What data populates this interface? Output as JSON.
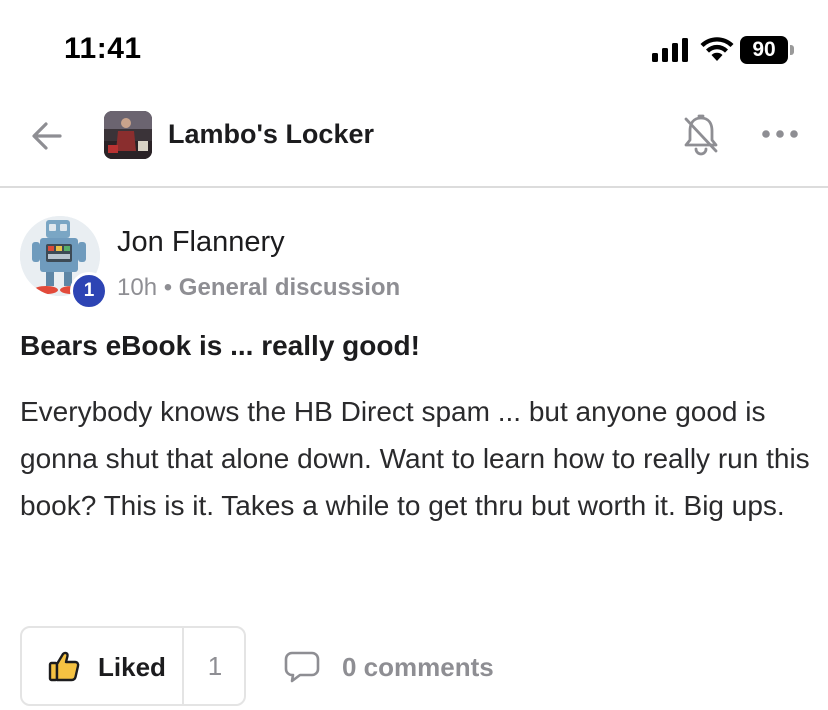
{
  "status_bar": {
    "time": "11:41",
    "battery_level": "90",
    "icons": [
      "signal-icon",
      "wifi-icon",
      "battery-icon"
    ]
  },
  "header": {
    "back_icon": "arrow-left-icon",
    "group_name": "Lambo's Locker",
    "bell_icon": "bell-muted-icon",
    "more_icon": "ellipsis-icon"
  },
  "post": {
    "author": "Jon Flannery",
    "level": "1",
    "time_ago": "10h",
    "separator": "•",
    "category": "General discussion",
    "title": "Bears eBook is ... really good!",
    "body": "Everybody knows the HB Direct spam ... but anyone good is gonna shut that alone down. Want to learn how to really run this book? This is it. Takes a while to get thru but worth it. Big ups."
  },
  "actions": {
    "like_label": "Liked",
    "like_count": "1",
    "comments_label": "0 comments"
  },
  "colors": {
    "badge": "#2d44b4",
    "muted_text": "#8e8e93",
    "thumb_yellow": "#f5c242",
    "divider": "#dcdcdc"
  }
}
